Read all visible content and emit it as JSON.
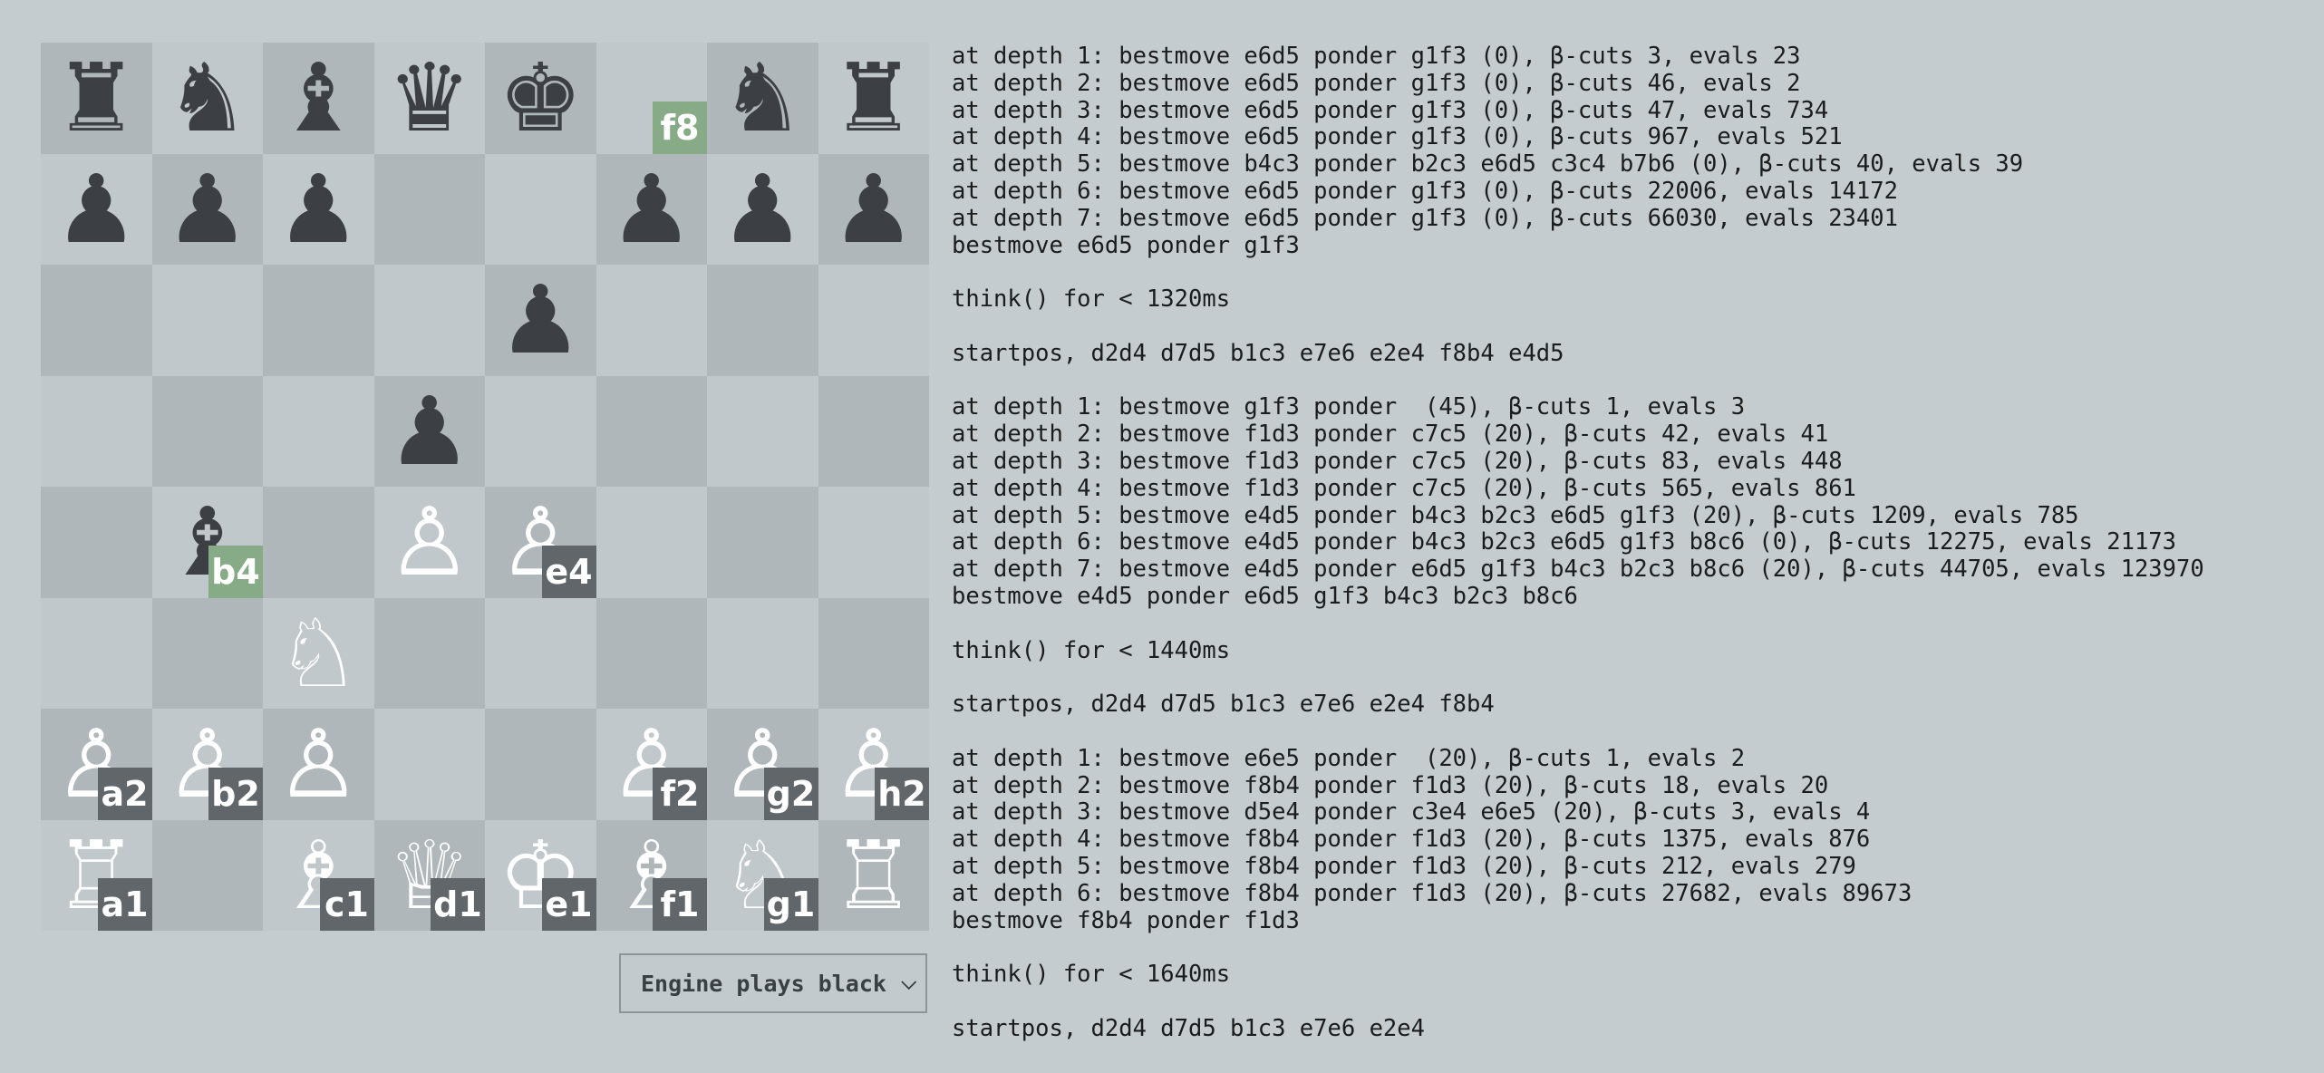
{
  "board": {
    "squares": [
      {
        "p": "♜",
        "c": "black",
        "label": ""
      },
      {
        "p": "♞",
        "c": "black",
        "label": ""
      },
      {
        "p": "♝",
        "c": "black",
        "label": ""
      },
      {
        "p": "♛",
        "c": "black",
        "label": ""
      },
      {
        "p": "♚",
        "c": "black",
        "label": ""
      },
      {
        "p": "",
        "c": "",
        "label": "f8",
        "hl": true,
        "top": true
      },
      {
        "p": "♞",
        "c": "black",
        "label": ""
      },
      {
        "p": "♜",
        "c": "black",
        "label": ""
      },
      {
        "p": "♟",
        "c": "black",
        "label": ""
      },
      {
        "p": "♟",
        "c": "black",
        "label": ""
      },
      {
        "p": "♟",
        "c": "black",
        "label": ""
      },
      {
        "p": "",
        "c": "",
        "label": ""
      },
      {
        "p": "",
        "c": "",
        "label": ""
      },
      {
        "p": "♟",
        "c": "black",
        "label": ""
      },
      {
        "p": "♟",
        "c": "black",
        "label": ""
      },
      {
        "p": "♟",
        "c": "black",
        "label": ""
      },
      {
        "p": "",
        "c": "",
        "label": ""
      },
      {
        "p": "",
        "c": "",
        "label": ""
      },
      {
        "p": "",
        "c": "",
        "label": ""
      },
      {
        "p": "",
        "c": "",
        "label": ""
      },
      {
        "p": "♟",
        "c": "black",
        "label": ""
      },
      {
        "p": "",
        "c": "",
        "label": ""
      },
      {
        "p": "",
        "c": "",
        "label": ""
      },
      {
        "p": "",
        "c": "",
        "label": ""
      },
      {
        "p": "",
        "c": "",
        "label": ""
      },
      {
        "p": "",
        "c": "",
        "label": ""
      },
      {
        "p": "",
        "c": "",
        "label": ""
      },
      {
        "p": "♟",
        "c": "black",
        "label": ""
      },
      {
        "p": "",
        "c": "",
        "label": ""
      },
      {
        "p": "",
        "c": "",
        "label": ""
      },
      {
        "p": "",
        "c": "",
        "label": ""
      },
      {
        "p": "",
        "c": "",
        "label": ""
      },
      {
        "p": "",
        "c": "",
        "label": ""
      },
      {
        "p": "♝",
        "c": "black",
        "label": "b4",
        "hl": true
      },
      {
        "p": "",
        "c": "",
        "label": ""
      },
      {
        "p": "♙",
        "c": "white",
        "label": ""
      },
      {
        "p": "♙",
        "c": "white",
        "label": "e4"
      },
      {
        "p": "",
        "c": "",
        "label": ""
      },
      {
        "p": "",
        "c": "",
        "label": ""
      },
      {
        "p": "",
        "c": "",
        "label": ""
      },
      {
        "p": "",
        "c": "",
        "label": ""
      },
      {
        "p": "",
        "c": "",
        "label": ""
      },
      {
        "p": "♘",
        "c": "white",
        "label": ""
      },
      {
        "p": "",
        "c": "",
        "label": ""
      },
      {
        "p": "",
        "c": "",
        "label": ""
      },
      {
        "p": "",
        "c": "",
        "label": ""
      },
      {
        "p": "",
        "c": "",
        "label": ""
      },
      {
        "p": "",
        "c": "",
        "label": ""
      },
      {
        "p": "♙",
        "c": "white",
        "label": "a2"
      },
      {
        "p": "♙",
        "c": "white",
        "label": "b2"
      },
      {
        "p": "♙",
        "c": "white",
        "label": ""
      },
      {
        "p": "",
        "c": "",
        "label": ""
      },
      {
        "p": "",
        "c": "",
        "label": ""
      },
      {
        "p": "♙",
        "c": "white",
        "label": "f2"
      },
      {
        "p": "♙",
        "c": "white",
        "label": "g2"
      },
      {
        "p": "♙",
        "c": "white",
        "label": "h2"
      },
      {
        "p": "♖",
        "c": "white",
        "label": "a1"
      },
      {
        "p": "",
        "c": "",
        "label": ""
      },
      {
        "p": "♗",
        "c": "white",
        "label": "c1"
      },
      {
        "p": "♕",
        "c": "white",
        "label": "d1"
      },
      {
        "p": "♔",
        "c": "white",
        "label": "e1"
      },
      {
        "p": "♗",
        "c": "white",
        "label": "f1"
      },
      {
        "p": "♘",
        "c": "white",
        "label": "g1"
      },
      {
        "p": "♖",
        "c": "white",
        "label": ""
      }
    ]
  },
  "engine_select": {
    "value": "Engine plays black"
  },
  "log": [
    "at depth 1: bestmove e6d5 ponder g1f3 (0), β-cuts 3, evals 23",
    "at depth 2: bestmove e6d5 ponder g1f3 (0), β-cuts 46, evals 2",
    "at depth 3: bestmove e6d5 ponder g1f3 (0), β-cuts 47, evals 734",
    "at depth 4: bestmove e6d5 ponder g1f3 (0), β-cuts 967, evals 521",
    "at depth 5: bestmove b4c3 ponder b2c3 e6d5 c3c4 b7b6 (0), β-cuts 40, evals 39",
    "at depth 6: bestmove e6d5 ponder g1f3 (0), β-cuts 22006, evals 14172",
    "at depth 7: bestmove e6d5 ponder g1f3 (0), β-cuts 66030, evals 23401",
    "bestmove e6d5 ponder g1f3",
    "",
    "think() for < 1320ms",
    "",
    "startpos, d2d4 d7d5 b1c3 e7e6 e2e4 f8b4 e4d5",
    "",
    "at depth 1: bestmove g1f3 ponder  (45), β-cuts 1, evals 3",
    "at depth 2: bestmove f1d3 ponder c7c5 (20), β-cuts 42, evals 41",
    "at depth 3: bestmove f1d3 ponder c7c5 (20), β-cuts 83, evals 448",
    "at depth 4: bestmove f1d3 ponder c7c5 (20), β-cuts 565, evals 861",
    "at depth 5: bestmove e4d5 ponder b4c3 b2c3 e6d5 g1f3 (20), β-cuts 1209, evals 785",
    "at depth 6: bestmove e4d5 ponder b4c3 b2c3 e6d5 g1f3 b8c6 (0), β-cuts 12275, evals 21173",
    "at depth 7: bestmove e4d5 ponder e6d5 g1f3 b4c3 b2c3 b8c6 (20), β-cuts 44705, evals 123970",
    "bestmove e4d5 ponder e6d5 g1f3 b4c3 b2c3 b8c6",
    "",
    "think() for < 1440ms",
    "",
    "startpos, d2d4 d7d5 b1c3 e7e6 e2e4 f8b4",
    "",
    "at depth 1: bestmove e6e5 ponder  (20), β-cuts 1, evals 2",
    "at depth 2: bestmove f8b4 ponder f1d3 (20), β-cuts 18, evals 20",
    "at depth 3: bestmove d5e4 ponder c3e4 e6e5 (20), β-cuts 3, evals 4",
    "at depth 4: bestmove f8b4 ponder f1d3 (20), β-cuts 1375, evals 876",
    "at depth 5: bestmove f8b4 ponder f1d3 (20), β-cuts 212, evals 279",
    "at depth 6: bestmove f8b4 ponder f1d3 (20), β-cuts 27682, evals 89673",
    "bestmove f8b4 ponder f1d3",
    "",
    "think() for < 1640ms",
    "",
    "startpos, d2d4 d7d5 b1c3 e7e6 e2e4"
  ]
}
